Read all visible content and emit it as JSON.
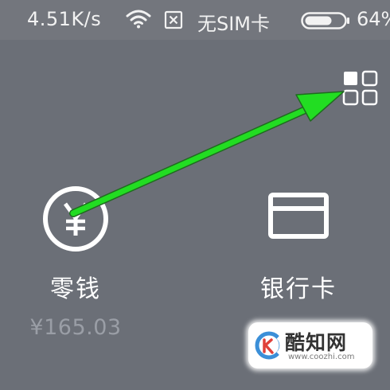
{
  "status_bar": {
    "network_speed": "4.51K/s",
    "sim_status": "无SIM卡",
    "battery_percent": "64%"
  },
  "wallet": {
    "change": {
      "label": "零钱",
      "amount": "¥165.03"
    },
    "bank_card": {
      "label": "银行卡"
    }
  },
  "watermark": {
    "title": "酷知网",
    "url": "www.coozhi.com"
  },
  "colors": {
    "background": "#6b6f77",
    "status_bar": "#73767d",
    "annotation_arrow": "#22dd22",
    "amount_text": "#9a9ea6"
  },
  "icons": {
    "apps": "grid-apps-icon",
    "change": "yuan-coin-icon",
    "bank_card": "card-icon",
    "wifi": "wifi-icon",
    "sim": "sim-off-icon",
    "battery": "battery-icon"
  }
}
